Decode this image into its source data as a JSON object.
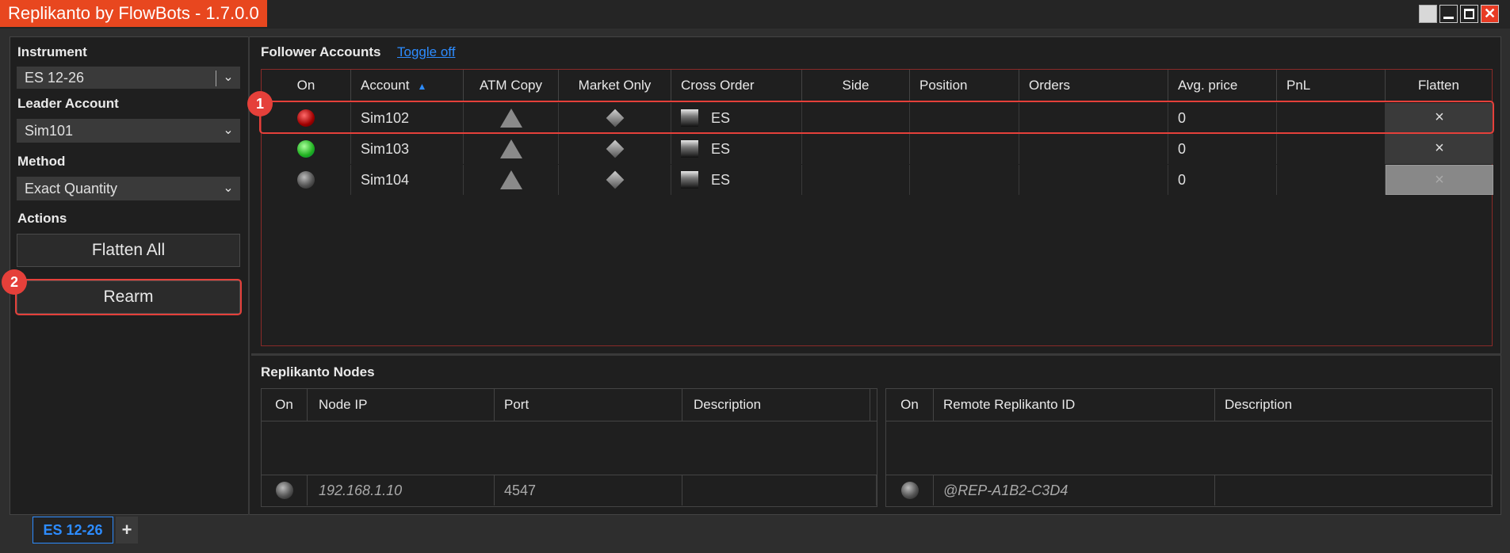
{
  "app": {
    "title": "Replikanto by FlowBots - 1.7.0.0"
  },
  "sidebar": {
    "instrument_label": "Instrument",
    "instrument_value": "ES 12-26",
    "leader_label": "Leader Account",
    "leader_value": "Sim101",
    "method_label": "Method",
    "method_value": "Exact Quantity",
    "actions_label": "Actions",
    "flatten_all": "Flatten All",
    "rearm": "Rearm"
  },
  "followers": {
    "title": "Follower Accounts",
    "toggle_link": "Toggle off",
    "columns": [
      "On",
      "Account",
      "ATM Copy",
      "Market Only",
      "Cross Order",
      "Side",
      "Position",
      "Orders",
      "Avg. price",
      "PnL",
      "Flatten"
    ],
    "rows": [
      {
        "status": "red",
        "account": "Sim102",
        "cross": "ES",
        "side": "",
        "position": "",
        "orders": "",
        "avg_price": "0",
        "pnl": "",
        "flatten": "×",
        "flatten_enabled": true
      },
      {
        "status": "green",
        "account": "Sim103",
        "cross": "ES",
        "side": "",
        "position": "",
        "orders": "",
        "avg_price": "0",
        "pnl": "",
        "flatten": "×",
        "flatten_enabled": true
      },
      {
        "status": "grey",
        "account": "Sim104",
        "cross": "ES",
        "side": "",
        "position": "",
        "orders": "",
        "avg_price": "0",
        "pnl": "",
        "flatten": "×",
        "flatten_enabled": false
      }
    ]
  },
  "nodes": {
    "title": "Replikanto Nodes",
    "left_columns": [
      "On",
      "Node IP",
      "Port",
      "Description"
    ],
    "left_row": {
      "status": "grey",
      "ip": "192.168.1.10",
      "port": "4547",
      "description": ""
    },
    "right_columns": [
      "On",
      "Remote Replikanto ID",
      "Description"
    ],
    "right_row": {
      "status": "grey",
      "id": "@REP-A1B2-C3D4",
      "description": ""
    }
  },
  "annotations": {
    "badge1": "1",
    "badge2": "2"
  },
  "tabs": {
    "active": "ES 12-26",
    "add": "+"
  },
  "colors": {
    "accent": "#e8471f",
    "link": "#2d8cff",
    "highlight": "#e5403a"
  }
}
